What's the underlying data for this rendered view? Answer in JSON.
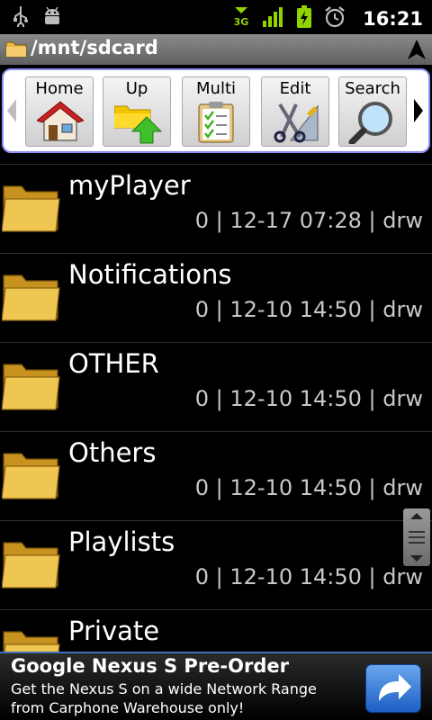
{
  "status_bar": {
    "icons_left": [
      "usb-icon",
      "android-debug-icon"
    ],
    "icons_right": [
      "signal-3g-icon",
      "signal-bars-icon",
      "battery-charging-icon",
      "alarm-icon"
    ],
    "time": "16:21"
  },
  "path_bar": {
    "path": "/mnt/sdcard"
  },
  "toolbar": {
    "buttons": [
      {
        "label": "Home",
        "icon": "home-icon"
      },
      {
        "label": "Up",
        "icon": "folder-up-icon"
      },
      {
        "label": "Multi",
        "icon": "checklist-icon"
      },
      {
        "label": "Edit",
        "icon": "edit-tools-icon"
      },
      {
        "label": "Search",
        "icon": "magnifier-icon"
      }
    ]
  },
  "files": [
    {
      "name": "myPlayer",
      "meta": "0 | 12-17 07:28 | drw"
    },
    {
      "name": "Notifications",
      "meta": "0 | 12-10 14:50 | drw"
    },
    {
      "name": "OTHER",
      "meta": "0 | 12-10 14:50 | drw"
    },
    {
      "name": "Others",
      "meta": "0 | 12-10 14:50 | drw"
    },
    {
      "name": "Playlists",
      "meta": "0 | 12-10 14:50 | drw"
    },
    {
      "name": "Private",
      "meta": ""
    }
  ],
  "ad": {
    "title": "Google Nexus S Pre-Order",
    "body": "Get the Nexus S on a wide Network Range from Carphone Warehouse only!"
  },
  "colors": {
    "toolbar_border": "#8d8dfc",
    "ad_border": "#3f6fb6",
    "signal_green": "#8fd400"
  }
}
